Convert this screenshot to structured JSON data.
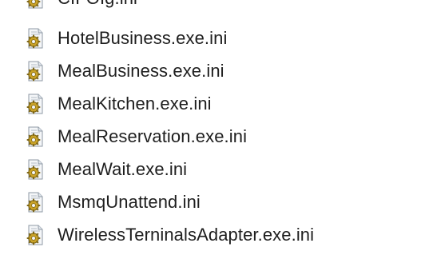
{
  "file_list": {
    "icon": "ini-config-file-icon",
    "items": [
      {
        "label": "CIFOIg.ini"
      },
      {
        "label": "HotelBusiness.exe.ini"
      },
      {
        "label": "MealBusiness.exe.ini"
      },
      {
        "label": "MealKitchen.exe.ini"
      },
      {
        "label": "MealReservation.exe.ini"
      },
      {
        "label": "MealWait.exe.ini"
      },
      {
        "label": "MsmqUnattend.ini"
      },
      {
        "label": "WirelessTerninalsAdapter.exe.ini"
      }
    ]
  }
}
